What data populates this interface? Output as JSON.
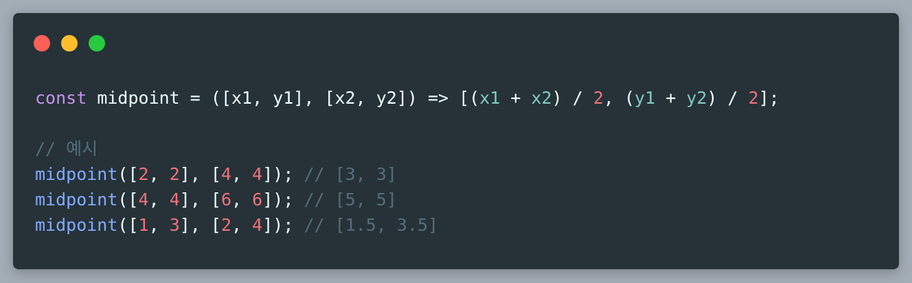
{
  "window": {
    "controls": [
      {
        "name": "close-button",
        "color": "#ff5f56"
      },
      {
        "name": "minimize-button",
        "color": "#ffbd2e"
      },
      {
        "name": "zoom-button",
        "color": "#27c93f"
      }
    ]
  },
  "code": {
    "language": "javascript",
    "lines": [
      [
        {
          "t": "const",
          "k": "kw"
        },
        {
          "t": " midpoint = ",
          "k": "plain"
        },
        {
          "t": "([x1, y1], [x2, y2]) => [(",
          "k": "plain"
        },
        {
          "t": "x1",
          "k": "param"
        },
        {
          "t": " + ",
          "k": "plain"
        },
        {
          "t": "x2",
          "k": "param"
        },
        {
          "t": ") / ",
          "k": "plain"
        },
        {
          "t": "2",
          "k": "num"
        },
        {
          "t": ", (",
          "k": "plain"
        },
        {
          "t": "y1",
          "k": "param"
        },
        {
          "t": " + ",
          "k": "plain"
        },
        {
          "t": "y2",
          "k": "param"
        },
        {
          "t": ") / ",
          "k": "plain"
        },
        {
          "t": "2",
          "k": "num"
        },
        {
          "t": "];",
          "k": "plain"
        }
      ],
      [],
      [
        {
          "t": "// 예시",
          "k": "comment"
        }
      ],
      [
        {
          "t": "midpoint",
          "k": "fn"
        },
        {
          "t": "([",
          "k": "plain"
        },
        {
          "t": "2",
          "k": "num"
        },
        {
          "t": ", ",
          "k": "plain"
        },
        {
          "t": "2",
          "k": "num"
        },
        {
          "t": "], [",
          "k": "plain"
        },
        {
          "t": "4",
          "k": "num"
        },
        {
          "t": ", ",
          "k": "plain"
        },
        {
          "t": "4",
          "k": "num"
        },
        {
          "t": "]); ",
          "k": "plain"
        },
        {
          "t": "// [3, 3]",
          "k": "comment"
        }
      ],
      [
        {
          "t": "midpoint",
          "k": "fn"
        },
        {
          "t": "([",
          "k": "plain"
        },
        {
          "t": "4",
          "k": "num"
        },
        {
          "t": ", ",
          "k": "plain"
        },
        {
          "t": "4",
          "k": "num"
        },
        {
          "t": "], [",
          "k": "plain"
        },
        {
          "t": "6",
          "k": "num"
        },
        {
          "t": ", ",
          "k": "plain"
        },
        {
          "t": "6",
          "k": "num"
        },
        {
          "t": "]); ",
          "k": "plain"
        },
        {
          "t": "// [5, 5]",
          "k": "comment"
        }
      ],
      [
        {
          "t": "midpoint",
          "k": "fn"
        },
        {
          "t": "([",
          "k": "plain"
        },
        {
          "t": "1",
          "k": "num"
        },
        {
          "t": ", ",
          "k": "plain"
        },
        {
          "t": "3",
          "k": "num"
        },
        {
          "t": "], [",
          "k": "plain"
        },
        {
          "t": "2",
          "k": "num"
        },
        {
          "t": ", ",
          "k": "plain"
        },
        {
          "t": "4",
          "k": "num"
        },
        {
          "t": "]); ",
          "k": "plain"
        },
        {
          "t": "// [1.5, 3.5]",
          "k": "comment"
        }
      ]
    ]
  }
}
